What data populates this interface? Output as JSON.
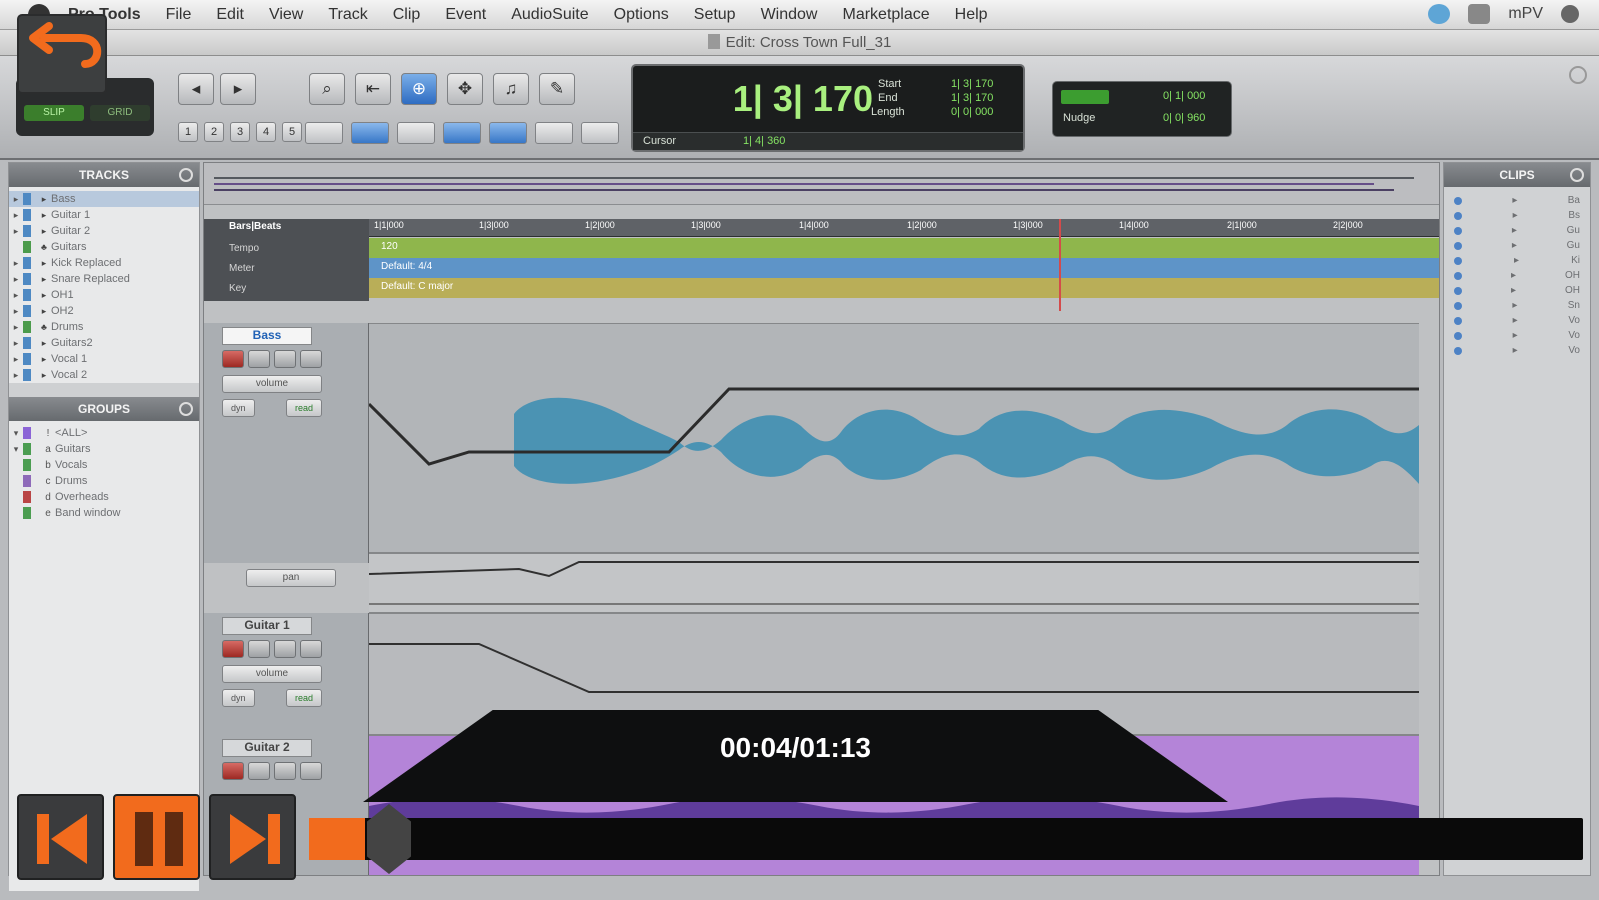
{
  "menubar": {
    "items": [
      "Pro Tools",
      "File",
      "Edit",
      "View",
      "Track",
      "Clip",
      "Event",
      "AudioSuite",
      "Options",
      "Setup",
      "Window",
      "Marketplace",
      "Help"
    ],
    "user": "mPV"
  },
  "window": {
    "title": "Edit: Cross Town Full_31"
  },
  "toolbar": {
    "mode_labels": [
      "SLIP",
      "GRID"
    ],
    "counter_main": "1| 3| 170",
    "start_label": "Start",
    "end_label": "End",
    "length_label": "Length",
    "start_value": "1| 3| 170",
    "end_value": "1| 3| 170",
    "length_value": "0| 0| 000",
    "cursor_label": "Cursor",
    "cursor_value": "1| 4| 360",
    "nudge_grid_value": "0| 1| 000",
    "nudge_label": "Nudge",
    "nudge_value": "0| 0| 960"
  },
  "tracks_panel": {
    "title": "TRACKS",
    "items": [
      "Bass",
      "Guitar 1",
      "Guitar 2",
      "Guitars",
      "Kick Replaced",
      "Snare Replaced",
      "OH1",
      "OH2",
      "Drums",
      "Guitars2",
      "Vocal 1",
      "Vocal 2"
    ]
  },
  "groups_panel": {
    "title": "GROUPS",
    "items": [
      {
        "prefix": "!",
        "name": "<ALL>"
      },
      {
        "prefix": "a",
        "name": "Guitars"
      },
      {
        "prefix": "b",
        "name": "Vocals"
      },
      {
        "prefix": "c",
        "name": "Drums"
      },
      {
        "prefix": "d",
        "name": "Overheads"
      },
      {
        "prefix": "e",
        "name": "Band window"
      }
    ]
  },
  "ruler": {
    "bars_beats": "Bars|Beats",
    "ticks": [
      "1|1|000",
      "1|3|000",
      "1|2|000",
      "1|3|000",
      "1|4|000",
      "1|2|000",
      "1|3|000",
      "1|4|000",
      "2|1|000",
      "2|2|000"
    ],
    "tempo_label": "Tempo",
    "tempo_value": "120",
    "meter_label": "Meter",
    "meter_value": "Default: 4/4",
    "key_label": "Key",
    "key_value": "Default: C major"
  },
  "tracks": [
    {
      "name": "Bass",
      "view": "volume",
      "dyn": "dyn",
      "read": "read",
      "pan": "pan"
    },
    {
      "name": "Guitar 1",
      "view": "volume",
      "dyn": "dyn",
      "read": "read"
    },
    {
      "name": "Guitar 2"
    }
  ],
  "clips_panel": {
    "title": "CLIPS",
    "items": [
      "Ba",
      "Bs",
      "Gu",
      "Gu",
      "Ki",
      "OH",
      "OH",
      "Sn",
      "Vo",
      "Vo",
      "Vo"
    ]
  },
  "player": {
    "time": "00:04/01:13",
    "progress": 0.044,
    "accent": "#f26b1d"
  }
}
